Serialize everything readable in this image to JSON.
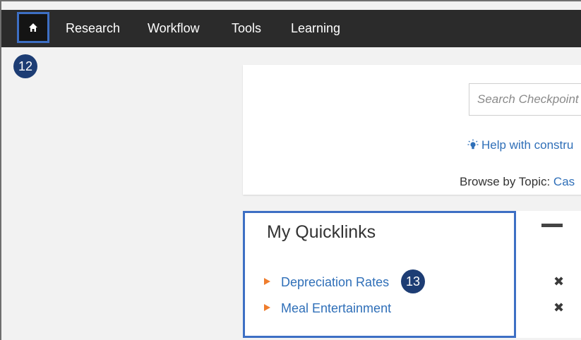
{
  "nav": {
    "home_icon": "home-icon",
    "items": [
      {
        "label": "Research"
      },
      {
        "label": "Workflow"
      },
      {
        "label": "Tools"
      },
      {
        "label": "Learning"
      }
    ]
  },
  "callouts": {
    "home": "12",
    "quicklink": "13"
  },
  "search": {
    "placeholder": "Search Checkpoint",
    "help_text": "Help with constru",
    "browse_label": "Browse by Topic: ",
    "browse_link": "Cas"
  },
  "quicklinks": {
    "title": "My Quicklinks",
    "items": [
      {
        "label": "Depreciation Rates"
      },
      {
        "label": "Meal Entertainment"
      }
    ],
    "collapse_icon": "minus-icon",
    "remove_icon": "close-icon"
  },
  "colors": {
    "nav_background": "#2b2b2b",
    "highlight_border": "#3d6fc4",
    "badge": "#1d3d74",
    "link": "#2f6fb8",
    "arrow": "#ef7d2d"
  }
}
